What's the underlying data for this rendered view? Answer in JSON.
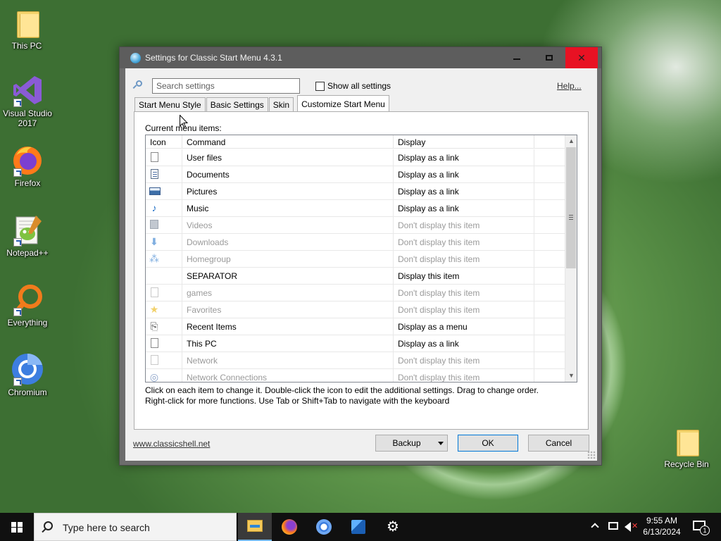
{
  "desktop": {
    "icons": [
      {
        "label": "This PC",
        "icon": "folder-icon"
      },
      {
        "label": "Visual Studio 2017",
        "icon": "visual-studio-icon"
      },
      {
        "label": "Firefox",
        "icon": "firefox-icon"
      },
      {
        "label": "Notepad++",
        "icon": "notepadpp-icon"
      },
      {
        "label": "Everything",
        "icon": "everything-search-icon"
      },
      {
        "label": "Chromium",
        "icon": "chromium-icon"
      },
      {
        "label": "Recycle Bin",
        "icon": "folder-icon"
      }
    ]
  },
  "window": {
    "title": "Settings for Classic Start Menu 4.3.1",
    "search_placeholder": "Search settings",
    "show_all_label": "Show all settings",
    "show_all_checked": false,
    "help_label": "Help...",
    "tabs": [
      {
        "label": "Start Menu Style",
        "active": false
      },
      {
        "label": "Basic Settings",
        "active": false
      },
      {
        "label": "Skin",
        "active": false
      },
      {
        "label": "Customize Start Menu",
        "active": true
      }
    ],
    "panel_label": "Current menu items:",
    "columns": [
      "Icon",
      "Command",
      "Display"
    ],
    "rows": [
      {
        "icon": "document-icon",
        "command": "User files",
        "display": "Display as a link",
        "enabled": true
      },
      {
        "icon": "documents-icon",
        "command": "Documents",
        "display": "Display as a link",
        "enabled": true
      },
      {
        "icon": "pictures-icon",
        "command": "Pictures",
        "display": "Display as a link",
        "enabled": true
      },
      {
        "icon": "music-note-icon",
        "command": "Music",
        "display": "Display as a link",
        "enabled": true
      },
      {
        "icon": "videos-icon",
        "command": "Videos",
        "display": "Don't display this item",
        "enabled": false
      },
      {
        "icon": "downloads-arrow-icon",
        "command": "Downloads",
        "display": "Don't display this item",
        "enabled": false
      },
      {
        "icon": "homegroup-icon",
        "command": "Homegroup",
        "display": "Don't display this item",
        "enabled": false
      },
      {
        "icon": "",
        "command": "SEPARATOR",
        "display": "Display this item",
        "enabled": true
      },
      {
        "icon": "document-icon",
        "command": "games",
        "display": "Don't display this item",
        "enabled": false
      },
      {
        "icon": "star-icon",
        "command": "Favorites",
        "display": "Don't display this item",
        "enabled": false
      },
      {
        "icon": "recent-items-icon",
        "command": "Recent Items",
        "display": "Display as a menu",
        "enabled": true
      },
      {
        "icon": "document-icon",
        "command": "This PC",
        "display": "Display as a link",
        "enabled": true
      },
      {
        "icon": "document-icon",
        "command": "Network",
        "display": "Don't display this item",
        "enabled": false
      },
      {
        "icon": "network-connections-icon",
        "command": "Network Connections",
        "display": "Don't display this item",
        "enabled": false
      }
    ],
    "hint_line1": "Click on each item to change it. Double-click the icon to edit the additional settings. Drag to change order.",
    "hint_line2": "Right-click for more functions. Use Tab or Shift+Tab to navigate with the keyboard",
    "footer_link": "www.classicshell.net",
    "backup_label": "Backup",
    "ok_label": "OK",
    "cancel_label": "Cancel"
  },
  "taskbar": {
    "search_placeholder": "Type here to search",
    "apps": [
      "file-explorer-icon",
      "firefox-icon",
      "chromium-icon",
      "photos-icon",
      "settings-gear-icon"
    ],
    "time": "9:55 AM",
    "date": "6/13/2024",
    "notification_count": "1"
  }
}
